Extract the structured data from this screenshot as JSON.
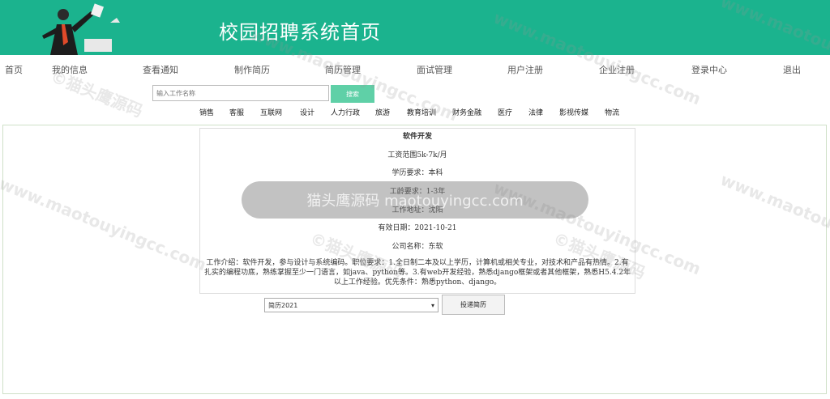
{
  "header": {
    "title": "校园招聘系统首页"
  },
  "nav": [
    "首页",
    "我的信息",
    "查看通知",
    "制作简历",
    "简历管理",
    "面试管理",
    "用户注册",
    "企业注册",
    "登录中心",
    "退出"
  ],
  "search": {
    "placeholder": "输入工作名称",
    "button": "搜索"
  },
  "categories": [
    "销售",
    "客服",
    "互联网",
    "设计",
    "人力行政",
    "旅游",
    "教育培训",
    "财务金融",
    "医疗",
    "法律",
    "影视传媒",
    "物流"
  ],
  "job": {
    "title": "软件开发",
    "salary": "工资范围5k-7k/月",
    "education": "学历要求：本科",
    "experience": "工龄要求：1-3年",
    "location": "工作地址：沈阳",
    "valid_date": "有效日期：2021-10-21",
    "company": "公司名称：东软",
    "description": "工作介绍：软件开发，参与设计与系统编码。职位要求：1.全日制二本及以上学历，计算机或相关专业，对技术和产品有热情。2.有扎实的编程功底，熟练掌握至少一门语言，如java、python等。3.有web开发经验，熟悉django框架或者其他框架，熟悉H5.4.2年以上工作经验。优先条件：熟悉python、django。"
  },
  "resume_select": {
    "value": "简历2021"
  },
  "submit": {
    "label": "投递简历"
  },
  "watermark": {
    "center": "猫头鹰源码 maotouyingcc.com",
    "tile": "www.maotouyingcc.com",
    "tile2": "©猫头鹰源码"
  },
  "colors": {
    "header_bg": "#1bb38e",
    "search_btn": "#5fd0a7"
  }
}
